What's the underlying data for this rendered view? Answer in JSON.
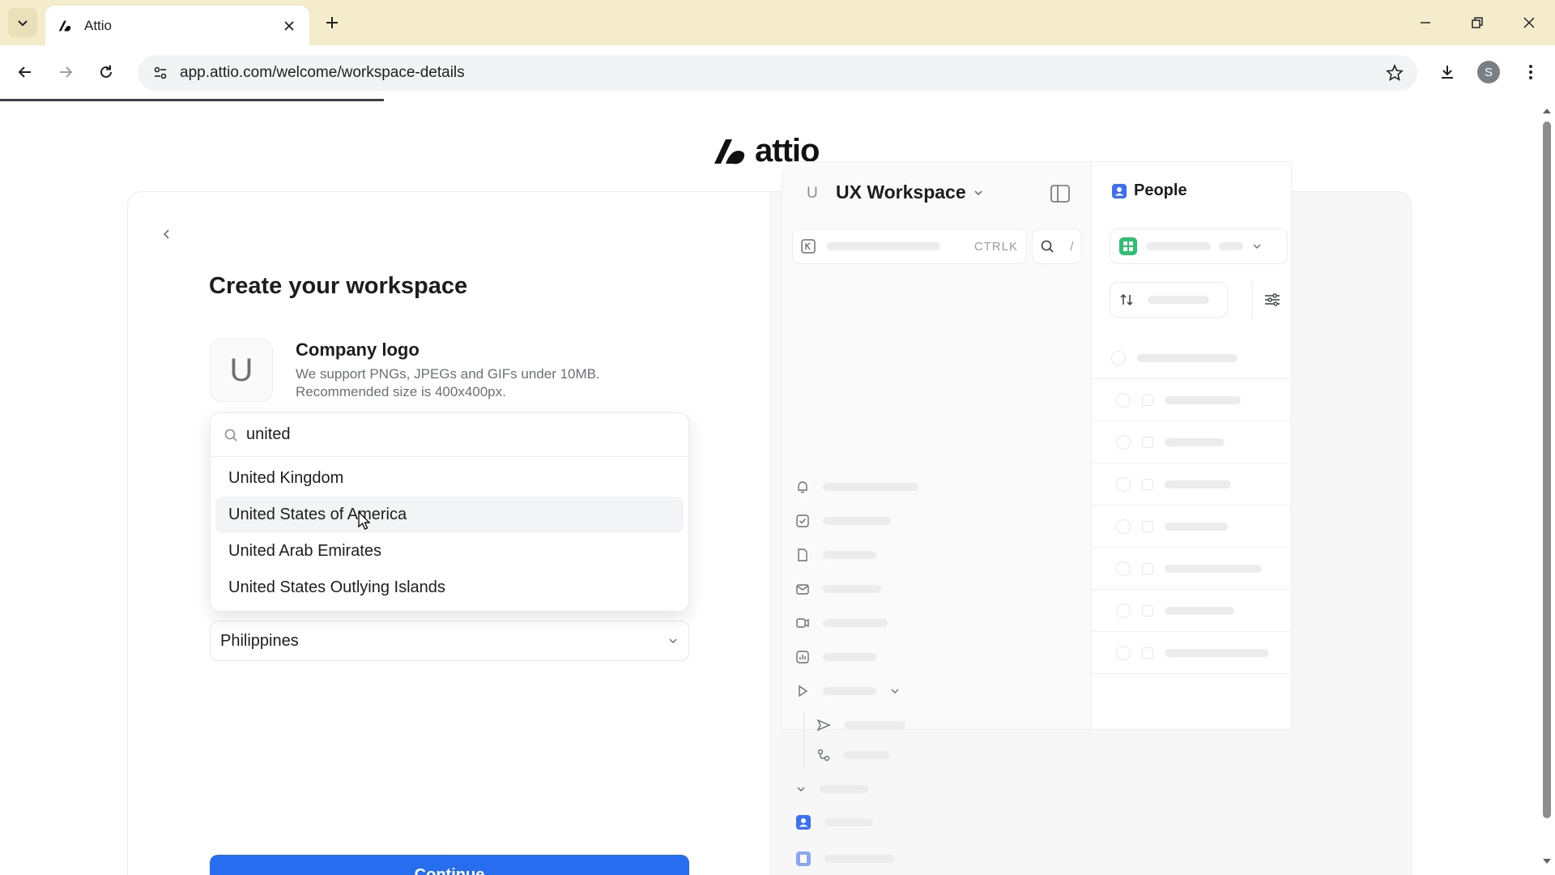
{
  "browser": {
    "tab_title": "Attio",
    "url": "app.attio.com/welcome/workspace-details",
    "profile_initial": "S"
  },
  "page": {
    "logo_text": "attio",
    "title": "Create your workspace",
    "logo_upload": {
      "initial": "U",
      "label": "Company logo",
      "help_line1": "We support PNGs, JPEGs and GIFs under 10MB.",
      "help_line2": "Recommended size is 400x400px."
    },
    "country_dropdown": {
      "search_value": "united",
      "options": [
        "United Kingdom",
        "United States of America",
        "United Arab Emirates",
        "United States Outlying Islands"
      ],
      "hovered_index": 1
    },
    "country_select_value": "Philippines",
    "continue_label": "Continue"
  },
  "preview": {
    "workspace_initial": "U",
    "workspace_name": "UX Workspace",
    "search_shortcut": "CTRLK",
    "slash_shortcut": "/",
    "people_label": "People"
  },
  "colors": {
    "accent": "#266df0",
    "tabbar_bg": "#f4eccb",
    "people_icon": "#3b6ff5",
    "view_icon": "#2fbf71"
  }
}
